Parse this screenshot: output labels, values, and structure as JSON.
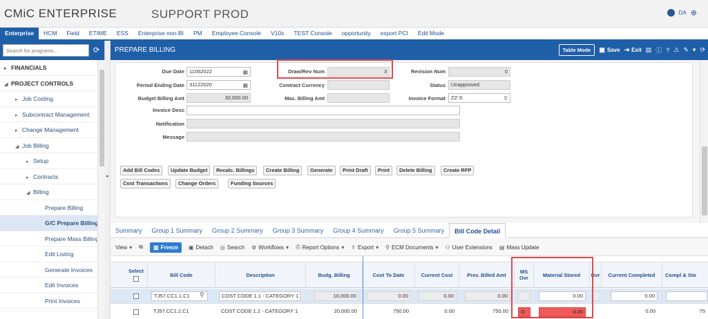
{
  "app": {
    "brand": "CMiC ENTERPRISE",
    "environment": "SUPPORT PROD",
    "user_initials": "DA"
  },
  "nav_tabs": [
    "Enterprise",
    "HCM",
    "Field",
    "ETIME",
    "ESS",
    "Enterprise non-BI",
    "PM",
    "Employee Console",
    "V10x",
    "TEST Console",
    "opportunity",
    "export PCI",
    "Edit Mode"
  ],
  "sidebar": {
    "search_placeholder": "Search for programs...",
    "items": [
      {
        "label": "FINANCIALS",
        "caret": "▸"
      },
      {
        "label": "PROJECT CONTROLS",
        "caret": "◢"
      },
      {
        "label": "Job Costing",
        "caret": "▸"
      },
      {
        "label": "Subcontract Management",
        "caret": "▸"
      },
      {
        "label": "Change Management",
        "caret": "▸"
      },
      {
        "label": "Job Billing",
        "caret": "◢"
      },
      {
        "label": "Setup",
        "caret": "▸"
      },
      {
        "label": "Contracts",
        "caret": "▸"
      },
      {
        "label": "Billing",
        "caret": "◢"
      },
      {
        "label": "Prepare Billing",
        "caret": ""
      },
      {
        "label": "G/C Prepare Billing",
        "caret": ""
      },
      {
        "label": "Prepare Mass Billing",
        "caret": ""
      },
      {
        "label": "Edit Listing",
        "caret": ""
      },
      {
        "label": "Generate Invoices",
        "caret": ""
      },
      {
        "label": "Edit Invoices",
        "caret": ""
      },
      {
        "label": "Print Invoices",
        "caret": ""
      }
    ]
  },
  "header": {
    "title": "PREPARE BILLING",
    "table_mode": "Table Mode",
    "save": "Save",
    "exit": "Exit"
  },
  "form": {
    "due_date_label": "Due Date",
    "due_date": "11062022",
    "period_end_label": "Period Ending Date",
    "period_end": "31122020",
    "budget_amt_label": "Budget Billing Amt",
    "budget_amt": "30,000.00",
    "invoice_desc_label": "Invoice Desc",
    "notification_label": "Notification",
    "message_label": "Message",
    "draw_rev_label": "Draw/Rev Num",
    "draw_rev": "3",
    "contract_currency_label": "Contract Currency",
    "max_billing_label": "Max. Billing Amt",
    "revision_num_label": "Revision Num",
    "revision_num": "0",
    "status_label": "Status",
    "status": "Unapproved",
    "invoice_format_label": "Invoice Format",
    "invoice_format": "ZZ-S"
  },
  "actions_row1": [
    "Add Bill Codes",
    "Update Budget",
    "Recalc. Billings",
    "Create Billing",
    "Generate",
    "Print Draft",
    "Print",
    "Delete Billing",
    "Create RFP"
  ],
  "actions_row2": [
    "Cost Transactions",
    "Change Orders",
    "Funding Sources"
  ],
  "sub_tabs": [
    "Summary",
    "Group 1 Summary",
    "Group 2 Summary",
    "Group 3 Summary",
    "Group 4 Summary",
    "Group 5 Summary",
    "Bill Code Detail"
  ],
  "grid_toolbar": {
    "view": "View",
    "freeze": "Freeze",
    "detach": "Detach",
    "search": "Search",
    "workflows": "Workflows",
    "report_options": "Report Options",
    "export": "Export",
    "ecm": "ECM Documents",
    "user_ext": "User Extensions",
    "mass_update": "Mass Update"
  },
  "grid": {
    "headers": {
      "select": "Select",
      "bill_code": "Bill Code",
      "description": "Description",
      "budg_billing": "Budg. Billing",
      "cost_to_date": "Cost To Date",
      "current_cost": "Current Cost",
      "prev_billed": "Prev. Billed Amt",
      "ms_ovr": "MS Ovr",
      "material_stored": "Material Stored",
      "ovr": "Ovr",
      "current_completed": "Current Completed",
      "compl_sto": "Compl & Sto"
    },
    "rows": [
      {
        "bill_code": "TJ57.CC1.1.C1",
        "description": "COST CODE 1.1 - CATEGORY 1",
        "budg_billing": "10,000.00",
        "cost_to_date": "0.00",
        "current_cost": "0.00",
        "prev_billed": "0.00",
        "ms_ovr": "",
        "material_stored": "0.00",
        "current_completed": "0.00",
        "compl_sto": ""
      },
      {
        "bill_code": "TJ57.CC1.2.C1",
        "description": "COST CODE 1.2 - CATEGORY 1",
        "budg_billing": "20,000.00",
        "cost_to_date": "750.00",
        "current_cost": "0.00",
        "prev_billed": "750.00",
        "ms_ovr": "O",
        "material_stored": "0.00",
        "current_completed": "0.00",
        "compl_sto": "75"
      }
    ]
  },
  "colors": {
    "brand_blue": "#1f5fa8",
    "highlight_red": "#e0484b",
    "ms_red": "#ef5b5b"
  }
}
